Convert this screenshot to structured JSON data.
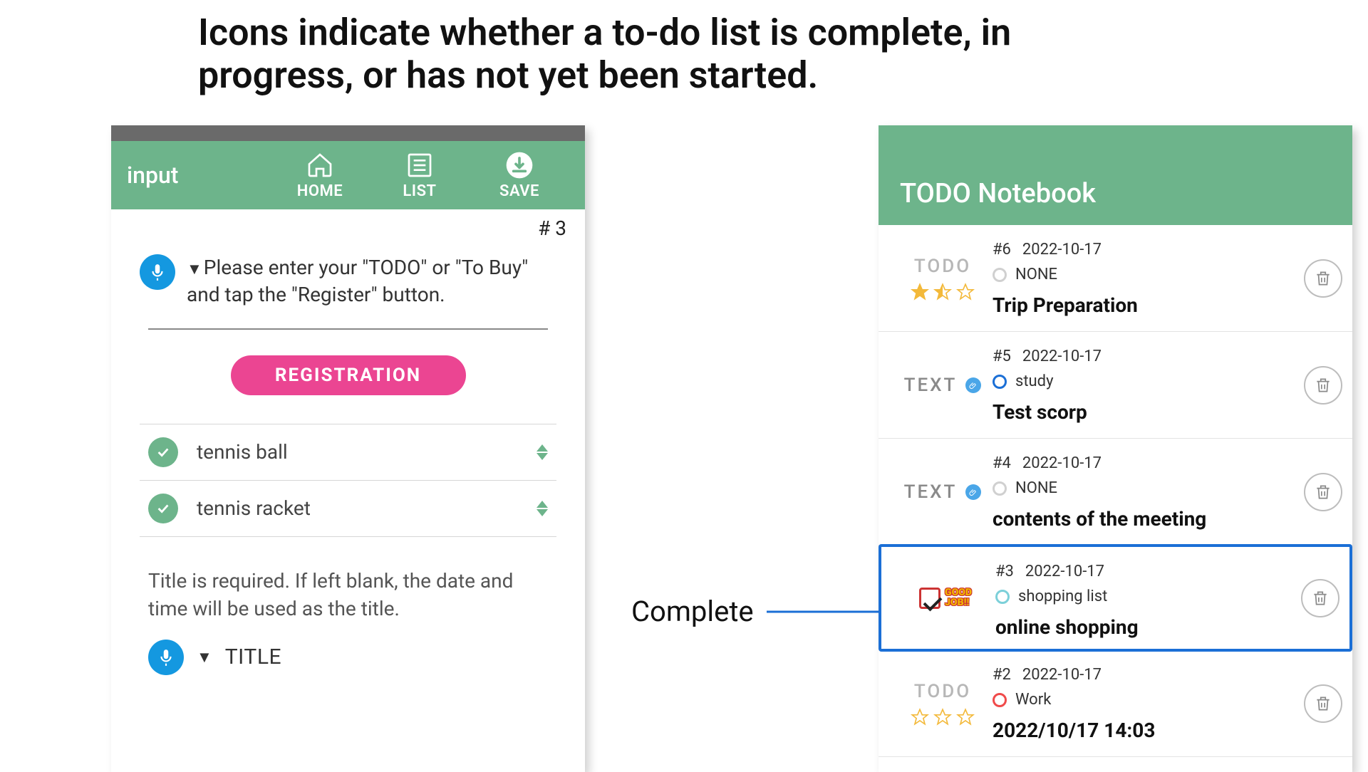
{
  "headline": "Icons indicate whether a to-do list is complete, in progress, or has not yet been started.",
  "left": {
    "appbar_title": "input",
    "actions": {
      "home": "HOME",
      "list": "LIST",
      "save": "SAVE"
    },
    "hash": "# 3",
    "hint": "Please enter your \"TODO\" or \"To Buy\" and tap the \"Register\" button.",
    "register_btn": "REGISTRATION",
    "items": [
      {
        "label": "tennis ball"
      },
      {
        "label": "tennis racket"
      }
    ],
    "title_note": "Title is required. If left blank, the date and time will be used as the title.",
    "title_label": "TITLE"
  },
  "annotation": {
    "label": "Complete"
  },
  "right": {
    "appbar_title": "TODO Notebook",
    "rows": [
      {
        "type": "TODO",
        "stars": 1.5,
        "num": "#6",
        "date": "2022-10-17",
        "tag": "NONE",
        "tag_color": "#d0d0d0",
        "title": "Trip Preparation"
      },
      {
        "type": "TEXT",
        "attach": true,
        "num": "#5",
        "date": "2022-10-17",
        "tag": "study",
        "tag_color": "#1b6fd6",
        "title": "Test scorp"
      },
      {
        "type": "TEXT",
        "attach": true,
        "num": "#4",
        "date": "2022-10-17",
        "tag": "NONE",
        "tag_color": "#d0d0d0",
        "title": "contents of the meeting"
      },
      {
        "type": "GOOD",
        "good1": "GOOD",
        "good2": "JOB!!",
        "num": "#3",
        "date": "2022-10-17",
        "tag": "shopping list",
        "tag_color": "#7cd0d9",
        "title": "online shopping",
        "highlight": true
      },
      {
        "type": "TODO",
        "stars": 0,
        "num": "#2",
        "date": "2022-10-17",
        "tag": "Work",
        "tag_color": "#f04a4a",
        "title": "2022/10/17 14:03"
      }
    ]
  }
}
